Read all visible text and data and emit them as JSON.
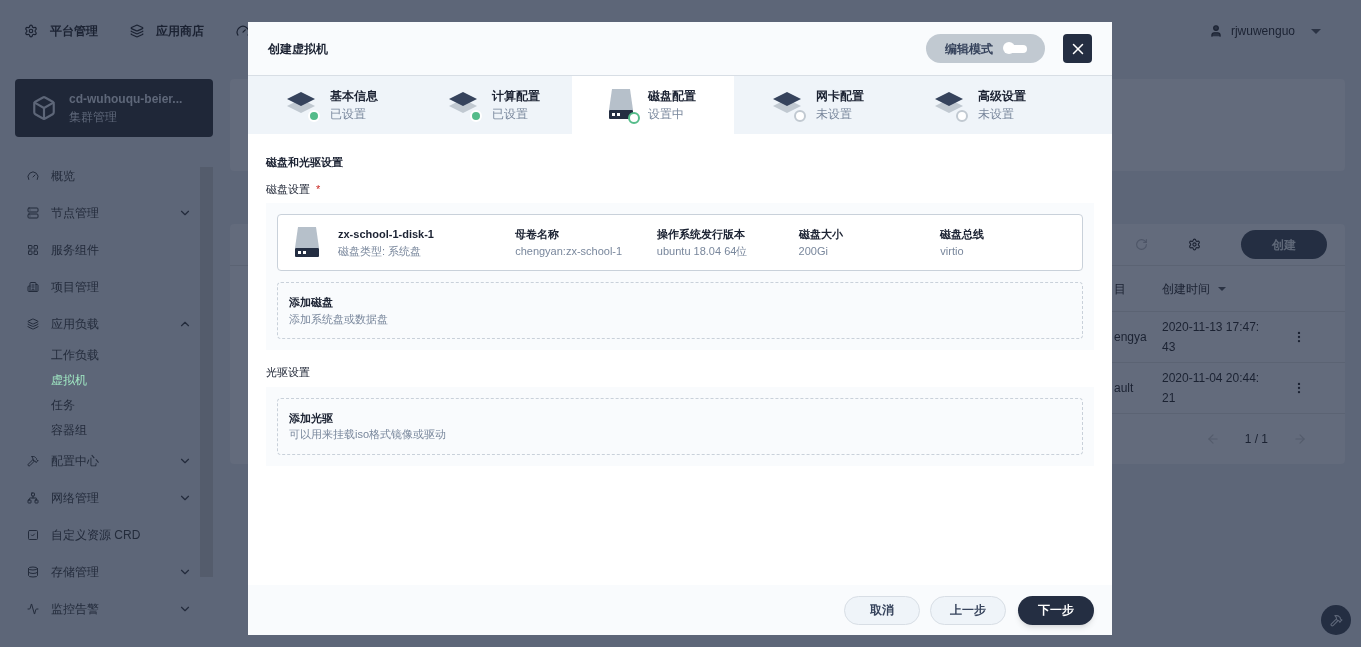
{
  "top_nav": {
    "items": [
      "平台管理",
      "应用商店"
    ],
    "user": "rjwuwenguo"
  },
  "cluster": {
    "name": "cd-wuhouqu-beier...",
    "subtitle": "集群管理"
  },
  "sidebar": {
    "items": [
      {
        "label": "概览"
      },
      {
        "label": "节点管理",
        "expanded": false
      },
      {
        "label": "服务组件"
      },
      {
        "label": "项目管理"
      },
      {
        "label": "应用负载",
        "expanded": true,
        "children": [
          {
            "label": "工作负载",
            "selected": false
          },
          {
            "label": "虚拟机",
            "selected": true
          },
          {
            "label": "任务",
            "selected": false
          },
          {
            "label": "容器组",
            "selected": false
          }
        ]
      },
      {
        "label": "配置中心",
        "expanded": false
      },
      {
        "label": "网络管理",
        "expanded": false
      },
      {
        "label": "自定义资源 CRD"
      },
      {
        "label": "存储管理",
        "expanded": false
      },
      {
        "label": "监控告警",
        "expanded": false
      }
    ]
  },
  "table": {
    "create_button": "创建",
    "columns": [
      "目",
      "创建时间"
    ],
    "rows": [
      {
        "column_1": "engya",
        "created": "2020-11-13 17:47:\n43"
      },
      {
        "column_1": "ault",
        "created": "2020-11-04 20:44:\n21"
      }
    ],
    "pagination": "1 / 1"
  },
  "dialog": {
    "title": "创建虚拟机",
    "edit_mode": {
      "label": "编辑模式",
      "on": false
    },
    "steps": [
      {
        "title": "基本信息",
        "status": "已设置",
        "kind": "layers",
        "selected": false,
        "completed": true
      },
      {
        "title": "计算配置",
        "status": "已设置",
        "kind": "layers",
        "selected": false,
        "completed": true
      },
      {
        "title": "磁盘配置",
        "status": "设置中",
        "kind": "disk",
        "selected": true,
        "completed": false
      },
      {
        "title": "网卡配置",
        "status": "未设置",
        "kind": "layers",
        "selected": false,
        "completed": false
      },
      {
        "title": "高级设置",
        "status": "未设置",
        "kind": "layers",
        "selected": false,
        "completed": false
      }
    ],
    "section_title": "磁盘和光驱设置",
    "disk_settings": {
      "label": "磁盘设置",
      "required_mark": "*",
      "disks": [
        {
          "name": "zx-school-1-disk-1",
          "type": "磁盘类型: 系统盘",
          "fields": [
            {
              "label": "母卷名称",
              "value": "chengyan:zx-school-1"
            },
            {
              "label": "操作系统发行版本",
              "value": "ubuntu 18.04 64位"
            },
            {
              "label": "磁盘大小",
              "value": "200Gi"
            },
            {
              "label": "磁盘总线",
              "value": "virtio"
            }
          ]
        }
      ],
      "add": {
        "title": "添加磁盘",
        "description": "添加系统盘或数据盘"
      }
    },
    "cdrom_settings": {
      "label": "光驱设置",
      "add": {
        "title": "添加光驱",
        "description": "可以用来挂载iso格式镜像或驱动"
      }
    },
    "buttons": [
      {
        "label": "取消",
        "kind": "secondary"
      },
      {
        "label": "上一步",
        "kind": "secondary"
      },
      {
        "label": "下一步",
        "kind": "primary"
      }
    ]
  }
}
